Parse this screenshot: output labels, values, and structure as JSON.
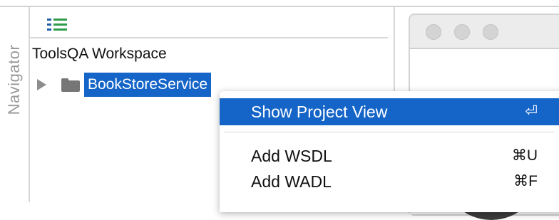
{
  "navigator": {
    "tab_label": "Navigator",
    "workspace": "ToolsQA Workspace",
    "tree": [
      {
        "label": "BookStoreService",
        "icon": "folder-icon",
        "selected": true,
        "expanded": false
      }
    ]
  },
  "context_menu": {
    "items": [
      {
        "label": "Show Project View",
        "shortcut": "⏎",
        "highlighted": true
      },
      {
        "label": "Add WSDL",
        "shortcut": "⌘U",
        "highlighted": false
      },
      {
        "label": "Add WADL",
        "shortcut": "⌘F",
        "highlighted": false
      }
    ]
  },
  "colors": {
    "selection": "#1565c8",
    "toolbar_icon": "#2e7d32"
  }
}
